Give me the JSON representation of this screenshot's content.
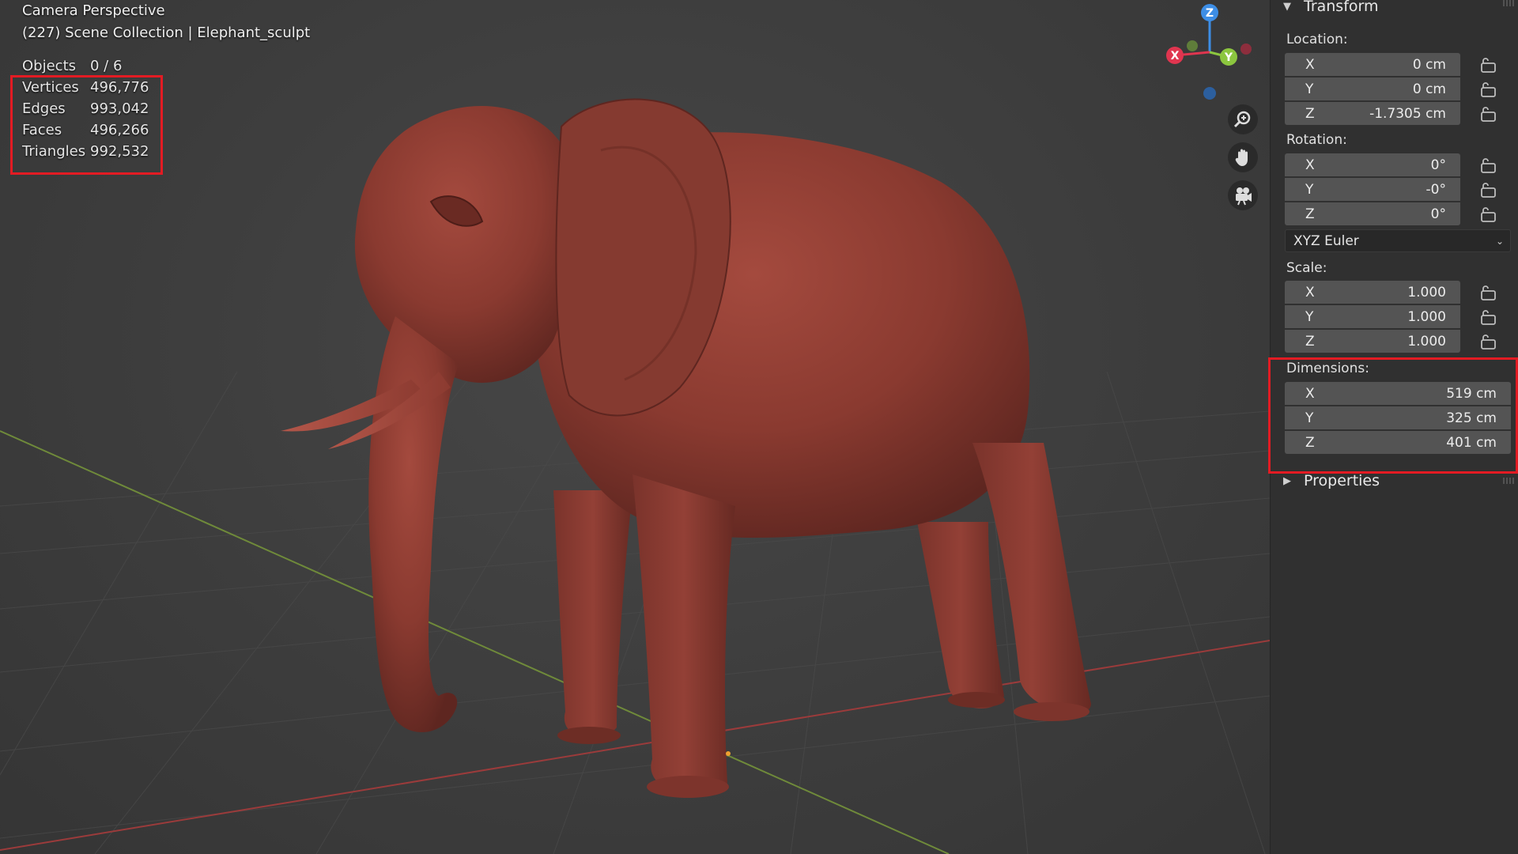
{
  "viewport": {
    "title": "Camera Perspective",
    "collection": "(227) Scene Collection | Elephant_sculpt",
    "stats": [
      {
        "label": "Objects",
        "value": "0 / 6"
      },
      {
        "label": "Vertices",
        "value": "496,776"
      },
      {
        "label": "Edges",
        "value": "993,042"
      },
      {
        "label": "Faces",
        "value": "496,266"
      },
      {
        "label": "Triangles",
        "value": "992,532"
      }
    ],
    "gizmo": {
      "x": "X",
      "y": "Y",
      "z": "Z"
    },
    "nav_buttons": [
      "zoom-icon",
      "hand-pan-icon",
      "camera-icon"
    ],
    "colors": {
      "model": "#8a3a30",
      "highlight": "#e31b23",
      "x_axis": "#e0354f",
      "y_axis": "#8cc63f",
      "z_axis": "#3d8ee6"
    }
  },
  "panel": {
    "transform_header": "Transform",
    "location": {
      "label": "Location:",
      "x": "0 cm",
      "y": "0 cm",
      "z": "-1.7305 cm"
    },
    "rotation": {
      "label": "Rotation:",
      "x": "0°",
      "y": "-0°",
      "z": "0°",
      "mode": "XYZ Euler"
    },
    "scale": {
      "label": "Scale:",
      "x": "1.000",
      "y": "1.000",
      "z": "1.000"
    },
    "dimensions": {
      "label": "Dimensions:",
      "x": "519 cm",
      "y": "325 cm",
      "z": "401 cm"
    },
    "axis_labels": {
      "x": "X",
      "y": "Y",
      "z": "Z"
    },
    "properties_header": "Properties"
  }
}
